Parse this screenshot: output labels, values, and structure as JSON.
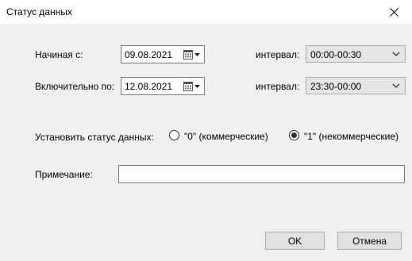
{
  "dialog": {
    "title": "Статус данных"
  },
  "from_row": {
    "label": "Начиная с:",
    "date": "09.08.2021",
    "interval_label": "интервал:",
    "interval_value": "00:00-00:30"
  },
  "to_row": {
    "label": "Включительно по:",
    "date": "12.08.2021",
    "interval_label": "интервал:",
    "interval_value": "23:30-00:00"
  },
  "status": {
    "label": "Установить статус данных:",
    "options": [
      {
        "label": "\"0\" (коммерческие)",
        "selected": false
      },
      {
        "label": "\"1\" (некоммерческие)",
        "selected": true
      }
    ]
  },
  "note": {
    "label": "Примечание:",
    "value": ""
  },
  "buttons": {
    "ok": "OK",
    "cancel": "Отмена"
  },
  "icons": {
    "close": "close-icon",
    "calendar": "calendar-icon",
    "dropdown": "chevron-down-icon"
  }
}
